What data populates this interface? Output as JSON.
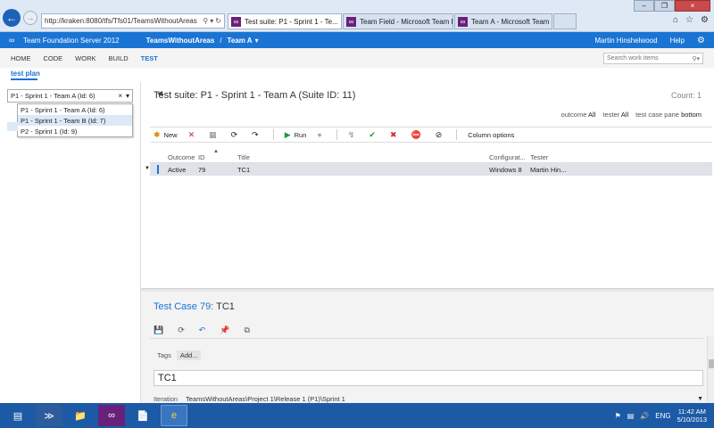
{
  "browser": {
    "address": "http://kraken:8080/tfs/Tfs01/TeamsWithoutAreas",
    "address_host": "kraken",
    "tabs": [
      {
        "label": "Test suite: P1 - Sprint 1 - Te...",
        "active": true
      },
      {
        "label": "Team Field - Microsoft Team F...",
        "active": false
      },
      {
        "label": "Team A - Microsoft Team Foundation",
        "active": false
      }
    ]
  },
  "header": {
    "product": "Team Foundation Server 2012",
    "project": "TeamsWithoutAreas",
    "team": "Team A",
    "user": "Martin Hinshelwood",
    "help": "Help"
  },
  "menu": {
    "items": [
      "HOME",
      "CODE",
      "WORK",
      "BUILD",
      "TEST"
    ],
    "active": "TEST",
    "search_placeholder": "Search work items"
  },
  "subnav": {
    "label": "test plan"
  },
  "plan": {
    "selected": "P1 - Sprint 1 - Team A (Id: 6)",
    "options": [
      "P1 - Sprint 1 - Team A (Id: 6)",
      "P1 - Sprint 1 - Team B (Id: 7)",
      "P2 - Sprint 1 (Id: 9)"
    ],
    "highlighted_index": 1
  },
  "suite": {
    "title": "Test suite: P1 - Sprint 1 - Team A (Suite ID: 11)",
    "count_label": "Count: 1",
    "filters": {
      "outcome_label": "outcome",
      "outcome_value": "All",
      "tester_label": "tester",
      "tester_value": "All",
      "pane_label": "test case pane",
      "pane_value": "bottom"
    }
  },
  "toolbar": {
    "new": "New",
    "run": "Run",
    "column_options": "Column options"
  },
  "grid": {
    "columns": [
      "Outcome",
      "ID",
      "Title",
      "Configurat...",
      "Tester"
    ],
    "rows": [
      {
        "outcome": "Active",
        "id": "79",
        "title": "TC1",
        "configuration": "Windows 8",
        "tester": "Martin Hin..."
      }
    ]
  },
  "test_case": {
    "label": "Test Case 79:",
    "name": "TC1",
    "tags_label": "Tags",
    "tags_add": "Add...",
    "title_value": "TC1",
    "iteration_label": "Iteration",
    "iteration_value": "TeamsWithoutAreas\\Project 1\\Release 1 (P1)\\Sprint 1"
  },
  "taskbar": {
    "lang": "ENG",
    "time": "11:42 AM",
    "date": "5/10/2013"
  }
}
